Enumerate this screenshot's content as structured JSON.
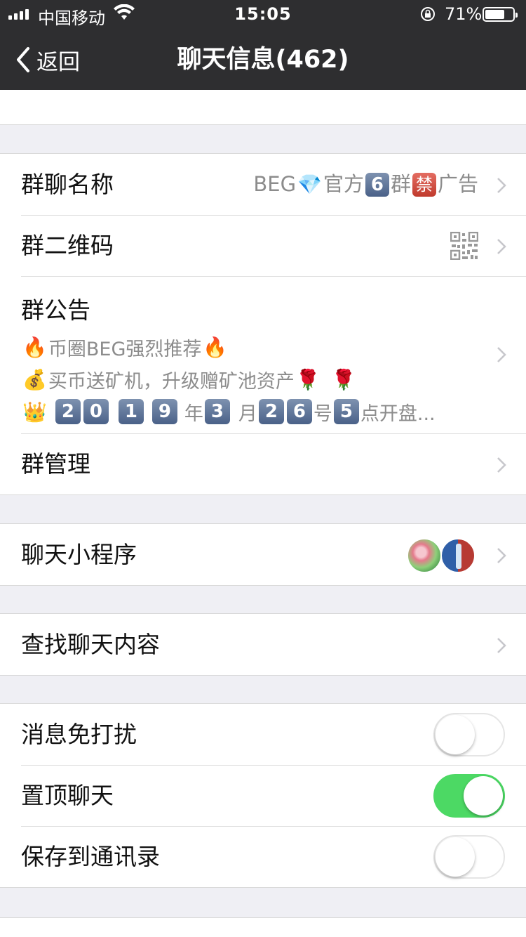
{
  "status_bar": {
    "carrier": "中国移动",
    "time": "15:05",
    "battery": "71%",
    "battery_level": 0.71
  },
  "nav": {
    "back_label": "返回",
    "title": "聊天信息(462)"
  },
  "group_name": {
    "label": "群聊名称",
    "value_prefix": "BEG",
    "value_gem": "💎",
    "value_mid": "官方",
    "value_num_badge": "6",
    "value_group": "群",
    "value_ban_badge": "禁",
    "value_suffix": "广告"
  },
  "qr_code": {
    "label": "群二维码",
    "icon": "qr-code-icon"
  },
  "announcement": {
    "label": "群公告",
    "line1": {
      "emoji_left": "🔥",
      "text": "币圈BEG强烈推荐",
      "emoji_right": "🔥"
    },
    "line2": {
      "emoji_left": "💰",
      "text": " 买币送矿机，升级赠矿池资产",
      "emoji_r1": "🌹",
      "emoji_r2": "🌹"
    },
    "line3": {
      "emoji_left": "👑",
      "d1": "2",
      "d2": "0",
      "d3": "1",
      "d4": "9",
      "year": "年",
      "d5": "3",
      "month": "月",
      "d6": "2",
      "d7": "6",
      "day": "号",
      "d8": "5",
      "tail": "点开盘..."
    }
  },
  "group_manage": {
    "label": "群管理"
  },
  "mini_programs": {
    "label": "聊天小程序"
  },
  "search_chat": {
    "label": "查找聊天内容"
  },
  "toggles": {
    "mute": {
      "label": "消息免打扰",
      "state": "off"
    },
    "pin": {
      "label": "置顶聊天",
      "state": "on"
    },
    "save_contacts": {
      "label": "保存到通讯录",
      "state": "off"
    }
  },
  "colors": {
    "nav_bg": "#2e2e30",
    "toggle_on": "#4cd964",
    "secondary_text": "#8c8c8c",
    "page_bg": "#efeff4"
  }
}
